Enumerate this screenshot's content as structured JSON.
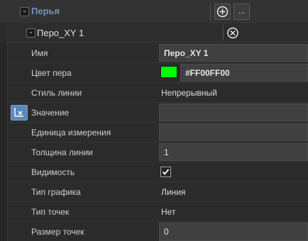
{
  "section": {
    "title": "Перья",
    "collapse_glyph": "-",
    "add_icon": "plus-circle-icon",
    "more_label": "..."
  },
  "pen": {
    "title": "Перо_XY 1",
    "collapse_glyph": "-",
    "remove_icon": "close-circle-icon"
  },
  "properties": {
    "name": {
      "label": "Имя",
      "value": "Перо_XY 1"
    },
    "color": {
      "label": "Цвет пера",
      "swatch": "#00FF00",
      "value": "#FF00FF00"
    },
    "line_style": {
      "label": "Стиль линии",
      "value": "Непрерывный"
    },
    "value": {
      "label": "Значение",
      "value": "",
      "binding_icon": "binding-icon"
    },
    "unit": {
      "label": "Единица измерения",
      "value": ""
    },
    "line_width": {
      "label": "Толщина линии",
      "value": "1"
    },
    "visibility": {
      "label": "Видимость",
      "checked": true
    },
    "chart_type": {
      "label": "Тип графика",
      "value": "Линия"
    },
    "point_type": {
      "label": "Тип точек",
      "value": "Нет"
    },
    "point_size": {
      "label": "Размер точек",
      "value": "0"
    }
  },
  "colors": {
    "accent_title": "#6f93c2",
    "binding_button": "#5b87b8"
  }
}
